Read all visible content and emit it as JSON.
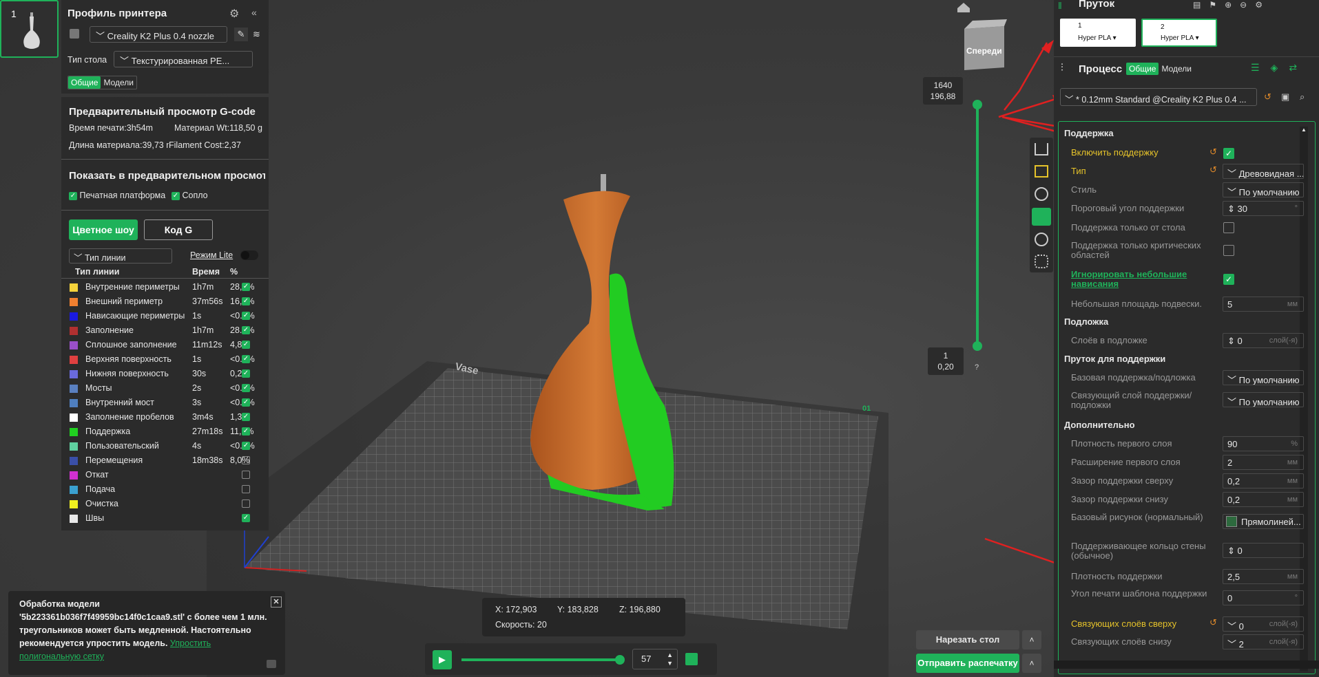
{
  "thumbnail": {
    "plate_number": "1"
  },
  "printer_panel": {
    "title": "Профиль принтера",
    "printer_name": "Creality K2 Plus 0.4 nozzle",
    "bed_label": "Тип стола",
    "bed_value": "Текстурированная PE...",
    "tab_general": "Общие",
    "tab_models": "Модели"
  },
  "preview": {
    "title": "Предварительный просмотр G-code",
    "print_time": "Время печати:3h54m",
    "material_weight": "Материал Wt:118,50 g",
    "material_length": "Длина материала:39,73 m",
    "filament_cost": "Filament Cost:2,37",
    "show_title": "Показать в предварительном просмотре",
    "show_platform": "Печатная платформа",
    "show_nozzle": "Сопло",
    "btn_color_show": "Цветное шоу",
    "btn_gcode": "Код G",
    "line_type_select": "Тип линии",
    "lite_mode": "Режим Lite",
    "col_type": "Тип линии",
    "col_time": "Время",
    "col_pct": "%",
    "rows": [
      {
        "name": "Внутренние периметры",
        "time": "1h7m",
        "pct": "28,8%",
        "color": "#f5d33b",
        "checked": true
      },
      {
        "name": "Внешний периметр",
        "time": "37m56s",
        "pct": "16,2%",
        "color": "#f08030",
        "checked": true
      },
      {
        "name": "Нависающие периметры",
        "time": "1s",
        "pct": "<0.1%",
        "color": "#1a1ae0",
        "checked": true
      },
      {
        "name": "Заполнение",
        "time": "1h7m",
        "pct": "28.9%",
        "color": "#b03030",
        "checked": true
      },
      {
        "name": "Сплошное заполнение",
        "time": "11m12s",
        "pct": "4,8%",
        "color": "#9a4fc9",
        "checked": true
      },
      {
        "name": "Верхняя поверхность",
        "time": "1s",
        "pct": "<0.1%",
        "color": "#e04040",
        "checked": true
      },
      {
        "name": "Нижняя поверхность",
        "time": "30s",
        "pct": "0,2%",
        "color": "#6a6adc",
        "checked": true
      },
      {
        "name": "Мосты",
        "time": "2s",
        "pct": "<0.1%",
        "color": "#5a80c0",
        "checked": true
      },
      {
        "name": "Внутренний мост",
        "time": "3s",
        "pct": "<0.1%",
        "color": "#4f7fbf",
        "checked": true
      },
      {
        "name": "Заполнение пробелов",
        "time": "3m4s",
        "pct": "1,3%",
        "color": "#ffffff",
        "checked": true
      },
      {
        "name": "Поддержка",
        "time": "27m18s",
        "pct": "11,7%",
        "color": "#20d020",
        "checked": true
      },
      {
        "name": "Пользовательский",
        "time": "4s",
        "pct": "<0.1%",
        "color": "#5fd0a0",
        "checked": true
      },
      {
        "name": "Перемещения",
        "time": "18m38s",
        "pct": "8,0%",
        "color": "#3a4fa8",
        "checked": false
      },
      {
        "name": "Откат",
        "time": "",
        "pct": "",
        "color": "#d030d0",
        "checked": false
      },
      {
        "name": "Подача",
        "time": "",
        "pct": "",
        "color": "#3aa0d0",
        "checked": false
      },
      {
        "name": "Очистка",
        "time": "",
        "pct": "",
        "color": "#f0f020",
        "checked": false
      },
      {
        "name": "Швы",
        "time": "",
        "pct": "",
        "color": "#e8e8e8",
        "checked": true
      }
    ]
  },
  "viewport": {
    "plate_label": "Vase",
    "plate_number": "01",
    "cube_label": "Спереди",
    "layer_top": "1640",
    "layer_top_height": "196,88",
    "layer_bottom": "1",
    "layer_bottom_height": "0,20",
    "help": "?"
  },
  "notification": {
    "text": "Обработка модели '5b223361b036f7f49959bc14f0c1caa9.stl' с более чем 1 млн. треугольников может быть медленной. Настоятельно рекомендуется упростить модель.",
    "link": "Упростить полигональную сетку"
  },
  "coords": {
    "x": "X: 172,903",
    "y": "Y: 183,828",
    "z": "Z: 196,880",
    "speed": "Скорость: 20"
  },
  "playback": {
    "layer_value": "57",
    "progress": 1.0
  },
  "actions": {
    "slice": "Нарезать стол",
    "send": "Отправить распечатку"
  },
  "filament": {
    "title": "Пруток",
    "slots": [
      {
        "num": "1",
        "name": "Hyper PLA"
      },
      {
        "num": "2",
        "name": "Hyper PLA"
      }
    ]
  },
  "process": {
    "title": "Процесс",
    "tab_general": "Общие",
    "tab_models": "Модели",
    "preset": "* 0.12mm Standard @Creality K2 Plus 0.4 ..."
  },
  "settings": {
    "sec_support": "Поддержка",
    "enable_support": "Включить поддержку",
    "type": "Тип",
    "type_value": "Древовидная ...",
    "style": "Стиль",
    "style_value": "По умолчанию",
    "threshold": "Пороговый угол поддержки",
    "threshold_value": "30",
    "threshold_unit": "°",
    "only_bed": "Поддержка только от стола",
    "only_critical": "Поддержка только критических областей",
    "ignore_small": "Игнорировать небольшие нависания",
    "small_area": "Небольшая площадь подвески.",
    "small_area_value": "5",
    "unit_mm": "мм",
    "sec_raft": "Подложка",
    "raft_layers": "Слоёв в подложке",
    "raft_layers_value": "0",
    "unit_layers": "слой(-я)",
    "sec_filament": "Пруток для поддержки",
    "base_support": "Базовая поддержка/подложка",
    "base_support_value": "По умолчанию",
    "interface": "Связующий слой поддержки/подложки",
    "interface_value": "По умолчанию",
    "sec_advanced": "Дополнительно",
    "first_density": "Плотность первого слоя",
    "first_density_value": "90",
    "unit_pct": "%",
    "first_expansion": "Расширение первого слоя",
    "first_expansion_value": "2",
    "top_gap": "Зазор поддержки сверху",
    "top_gap_value": "0,2",
    "bottom_gap": "Зазор поддержки снизу",
    "bottom_gap_value": "0,2",
    "base_pattern": "Базовый рисунок (нормальный)",
    "base_pattern_value": "Прямолиней...",
    "ring": "Поддерживающее кольцо стены (обычное)",
    "ring_value": "0",
    "support_density": "Плотность поддержки",
    "support_density_value": "2,5",
    "pattern_angle": "Угол печати шаблона поддержки",
    "pattern_angle_value": "0",
    "top_layers": "Связующих слоёв сверху",
    "top_layers_value": "0",
    "bottom_layers": "Связующих слоёв снизу",
    "bottom_layers_value": "2"
  },
  "colors": {
    "accent": "#1fb25a",
    "arrow": "#e02020",
    "model": "#c86a2a",
    "support": "#22cc22"
  }
}
